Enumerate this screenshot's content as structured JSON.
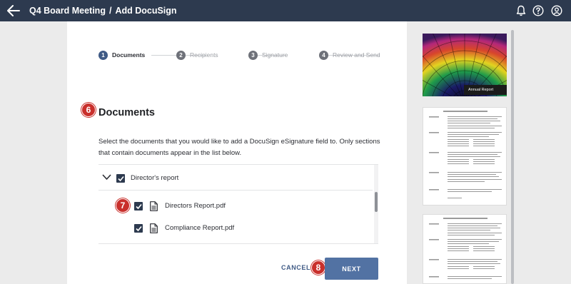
{
  "header": {
    "meeting": "Q4 Board Meeting",
    "separator": "/",
    "page": "Add DocuSign"
  },
  "steps": [
    {
      "num": "1",
      "label": "Documents",
      "state": "active"
    },
    {
      "num": "2",
      "label": "Recipients",
      "state": "inactive"
    },
    {
      "num": "3",
      "label": "Signature",
      "state": "inactive"
    },
    {
      "num": "4",
      "label": "Review and Send",
      "state": "inactive"
    }
  ],
  "callouts": {
    "c6": "6",
    "c7": "7",
    "c8": "8"
  },
  "section": {
    "title": "Documents",
    "description": "Select the documents that you would like to add a DocuSign eSignature field to. Only sections that contain documents appear in the list below."
  },
  "documents": {
    "group": {
      "label": "Director's report",
      "checked": true,
      "expanded": true
    },
    "items": [
      {
        "label": "Directors Report.pdf",
        "checked": true
      },
      {
        "label": "Compliance Report.pdf",
        "checked": true
      }
    ]
  },
  "actions": {
    "cancel": "CANCEL",
    "next": "NEXT"
  },
  "preview": {
    "cover_label": "Annual Report"
  },
  "colors": {
    "topbar": "#2d3a4f",
    "accent": "#5272a3",
    "step_active": "#3f5a85",
    "callout": "#c9302c"
  },
  "icons": [
    "back-arrow-icon",
    "bell-icon",
    "help-icon",
    "user-icon",
    "chevron-down-icon",
    "checkbox-checked-icon",
    "document-icon"
  ]
}
